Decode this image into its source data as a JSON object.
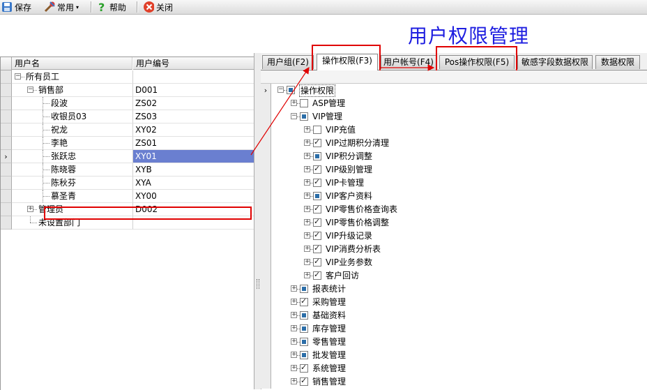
{
  "toolbar": {
    "save_label": "保存",
    "common_label": "常用",
    "help_label": "帮助",
    "close_label": "关闭"
  },
  "page_title": "用户权限管理",
  "left_grid": {
    "col_name": "用户名",
    "col_code": "用户编号",
    "rows": [
      {
        "name": "所有员工",
        "code": ""
      },
      {
        "name": "销售部",
        "code": "D001"
      },
      {
        "name": "段波",
        "code": "ZS02"
      },
      {
        "name": "收银员03",
        "code": "ZS03"
      },
      {
        "name": "祝龙",
        "code": "XY02"
      },
      {
        "name": "李艳",
        "code": "ZS01"
      },
      {
        "name": "张跃忠",
        "code": "XY01"
      },
      {
        "name": "陈晓蓉",
        "code": "XYB"
      },
      {
        "name": "陈秋芬",
        "code": "XYA"
      },
      {
        "name": "慕圣青",
        "code": "XY00"
      },
      {
        "name": "管理员",
        "code": "D002"
      },
      {
        "name": "未设置部门",
        "code": ""
      }
    ]
  },
  "tabs": [
    {
      "label": "用户组(F2)"
    },
    {
      "label": "操作权限(F3)"
    },
    {
      "label": "用户帐号(F4)"
    },
    {
      "label": "Pos操作权限(F5)"
    },
    {
      "label": "敏感字段数据权限"
    },
    {
      "label": "数据权限"
    }
  ],
  "tree": [
    {
      "label": "操作权限",
      "state": "partial"
    },
    {
      "label": "ASP管理",
      "state": "unchecked"
    },
    {
      "label": "VIP管理",
      "state": "partial"
    },
    {
      "label": "VIP充值",
      "state": "unchecked"
    },
    {
      "label": "VIP过期积分清理",
      "state": "checked"
    },
    {
      "label": "VIP积分调整",
      "state": "partial"
    },
    {
      "label": "VIP级别管理",
      "state": "checked"
    },
    {
      "label": "VIP卡管理",
      "state": "checked"
    },
    {
      "label": "VIP客户资料",
      "state": "partial"
    },
    {
      "label": "VIP零售价格查询表",
      "state": "checked"
    },
    {
      "label": "VIP零售价格调整",
      "state": "checked"
    },
    {
      "label": "VIP升级记录",
      "state": "checked"
    },
    {
      "label": "VIP消费分析表",
      "state": "checked"
    },
    {
      "label": "VIP业务参数",
      "state": "checked"
    },
    {
      "label": "客户回访",
      "state": "checked"
    },
    {
      "label": "报表统计",
      "state": "partial"
    },
    {
      "label": "采购管理",
      "state": "checked"
    },
    {
      "label": "基础资料",
      "state": "partial"
    },
    {
      "label": "库存管理",
      "state": "partial"
    },
    {
      "label": "零售管理",
      "state": "partial"
    },
    {
      "label": "批发管理",
      "state": "partial"
    },
    {
      "label": "系统管理",
      "state": "checked"
    },
    {
      "label": "销售管理",
      "state": "checked"
    }
  ],
  "colors": {
    "title": "#1e1ee0",
    "highlight": "#e00000",
    "selection": "#6a7fd0"
  }
}
